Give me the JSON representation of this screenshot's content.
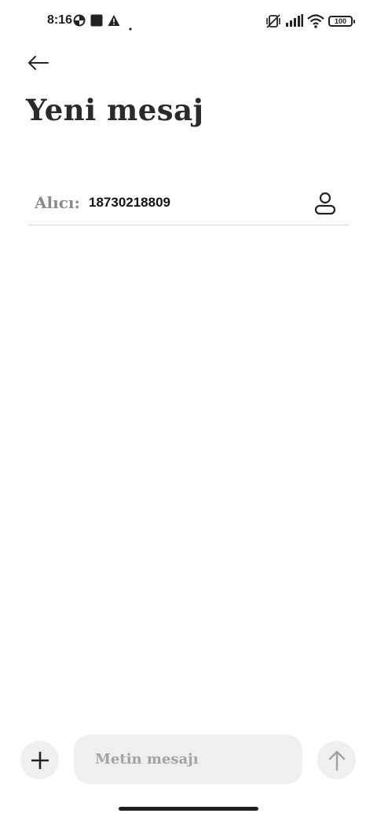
{
  "status_bar": {
    "time": "8:16",
    "battery": "100",
    "left_icons": [
      "data-saver-icon",
      "square-notification-icon",
      "warning-icon",
      "dot-icon"
    ],
    "right_icons": [
      "vibrate-off-icon",
      "signal-bars-icon",
      "wifi-icon",
      "battery-icon"
    ]
  },
  "header": {
    "back_icon": "arrow-left-icon",
    "title": "Yeni mesaj"
  },
  "recipient": {
    "label": "Alıcı:",
    "value": "18730218809",
    "contact_icon": "person-icon"
  },
  "composer": {
    "attach_icon": "plus-icon",
    "placeholder": "Metin mesajı",
    "send_icon": "arrow-up-icon"
  },
  "colors": {
    "background": "#ffffff",
    "pill": "#efefef",
    "placeholder": "#a3a3a3",
    "divider": "#d6d6d6",
    "text": "#222222"
  }
}
